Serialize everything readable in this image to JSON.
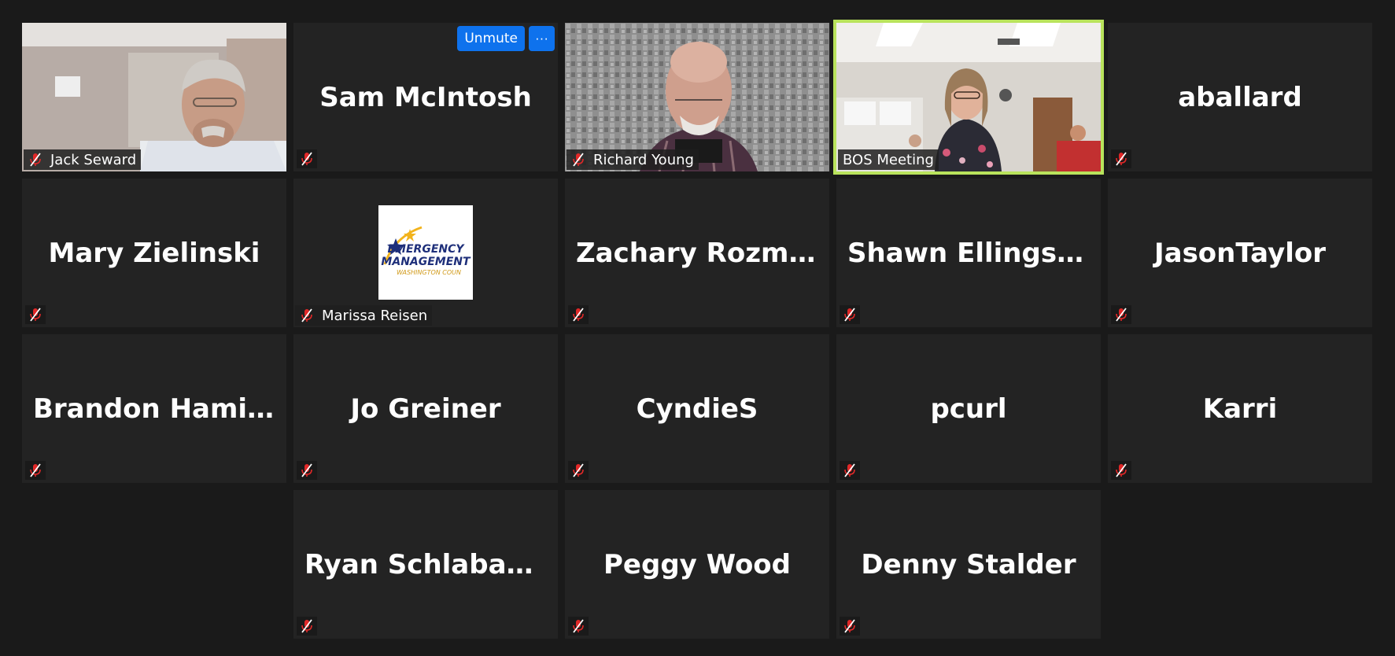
{
  "colors": {
    "background": "#1a1a1a",
    "tile": "#232323",
    "active_speaker_border": "#b9e35c",
    "button_blue": "#0e72ed",
    "muted_red": "#e02828"
  },
  "controls": {
    "unmute_label": "Unmute",
    "more_label": "···"
  },
  "participants": [
    {
      "name": "Jack Seward",
      "video": true,
      "muted": true
    },
    {
      "name": "Sam McIntosh",
      "video": false,
      "muted": true
    },
    {
      "name": "Richard Young",
      "video": true,
      "muted": true
    },
    {
      "name": "BOS Meeting",
      "video": true,
      "muted": false,
      "active_speaker": true
    },
    {
      "name": "aballard",
      "video": false,
      "muted": true
    },
    {
      "name": "Mary Zielinski",
      "video": false,
      "muted": true
    },
    {
      "name": "Marissa Reisen",
      "video": false,
      "muted": true,
      "profile_image": "emergency-management-logo"
    },
    {
      "name": "Zachary  Rozmu...",
      "video": false,
      "muted": true
    },
    {
      "name": "Shawn Ellingson",
      "video": false,
      "muted": true
    },
    {
      "name": "JasonTaylor",
      "video": false,
      "muted": true
    },
    {
      "name": "Brandon  Hamilt...",
      "video": false,
      "muted": true
    },
    {
      "name": "Jo Greiner",
      "video": false,
      "muted": true
    },
    {
      "name": "CyndieS",
      "video": false,
      "muted": true
    },
    {
      "name": "pcurl",
      "video": false,
      "muted": true
    },
    {
      "name": "Karri",
      "video": false,
      "muted": true
    },
    {
      "name": "Ryan Schlabaugh",
      "video": false,
      "muted": true
    },
    {
      "name": "Peggy Wood",
      "video": false,
      "muted": true
    },
    {
      "name": "Denny Stalder",
      "video": false,
      "muted": true
    }
  ],
  "logo": {
    "line1": "EMERGENCY",
    "line2": "MANAGEMENT",
    "line3": "WASHINGTON COUN"
  }
}
